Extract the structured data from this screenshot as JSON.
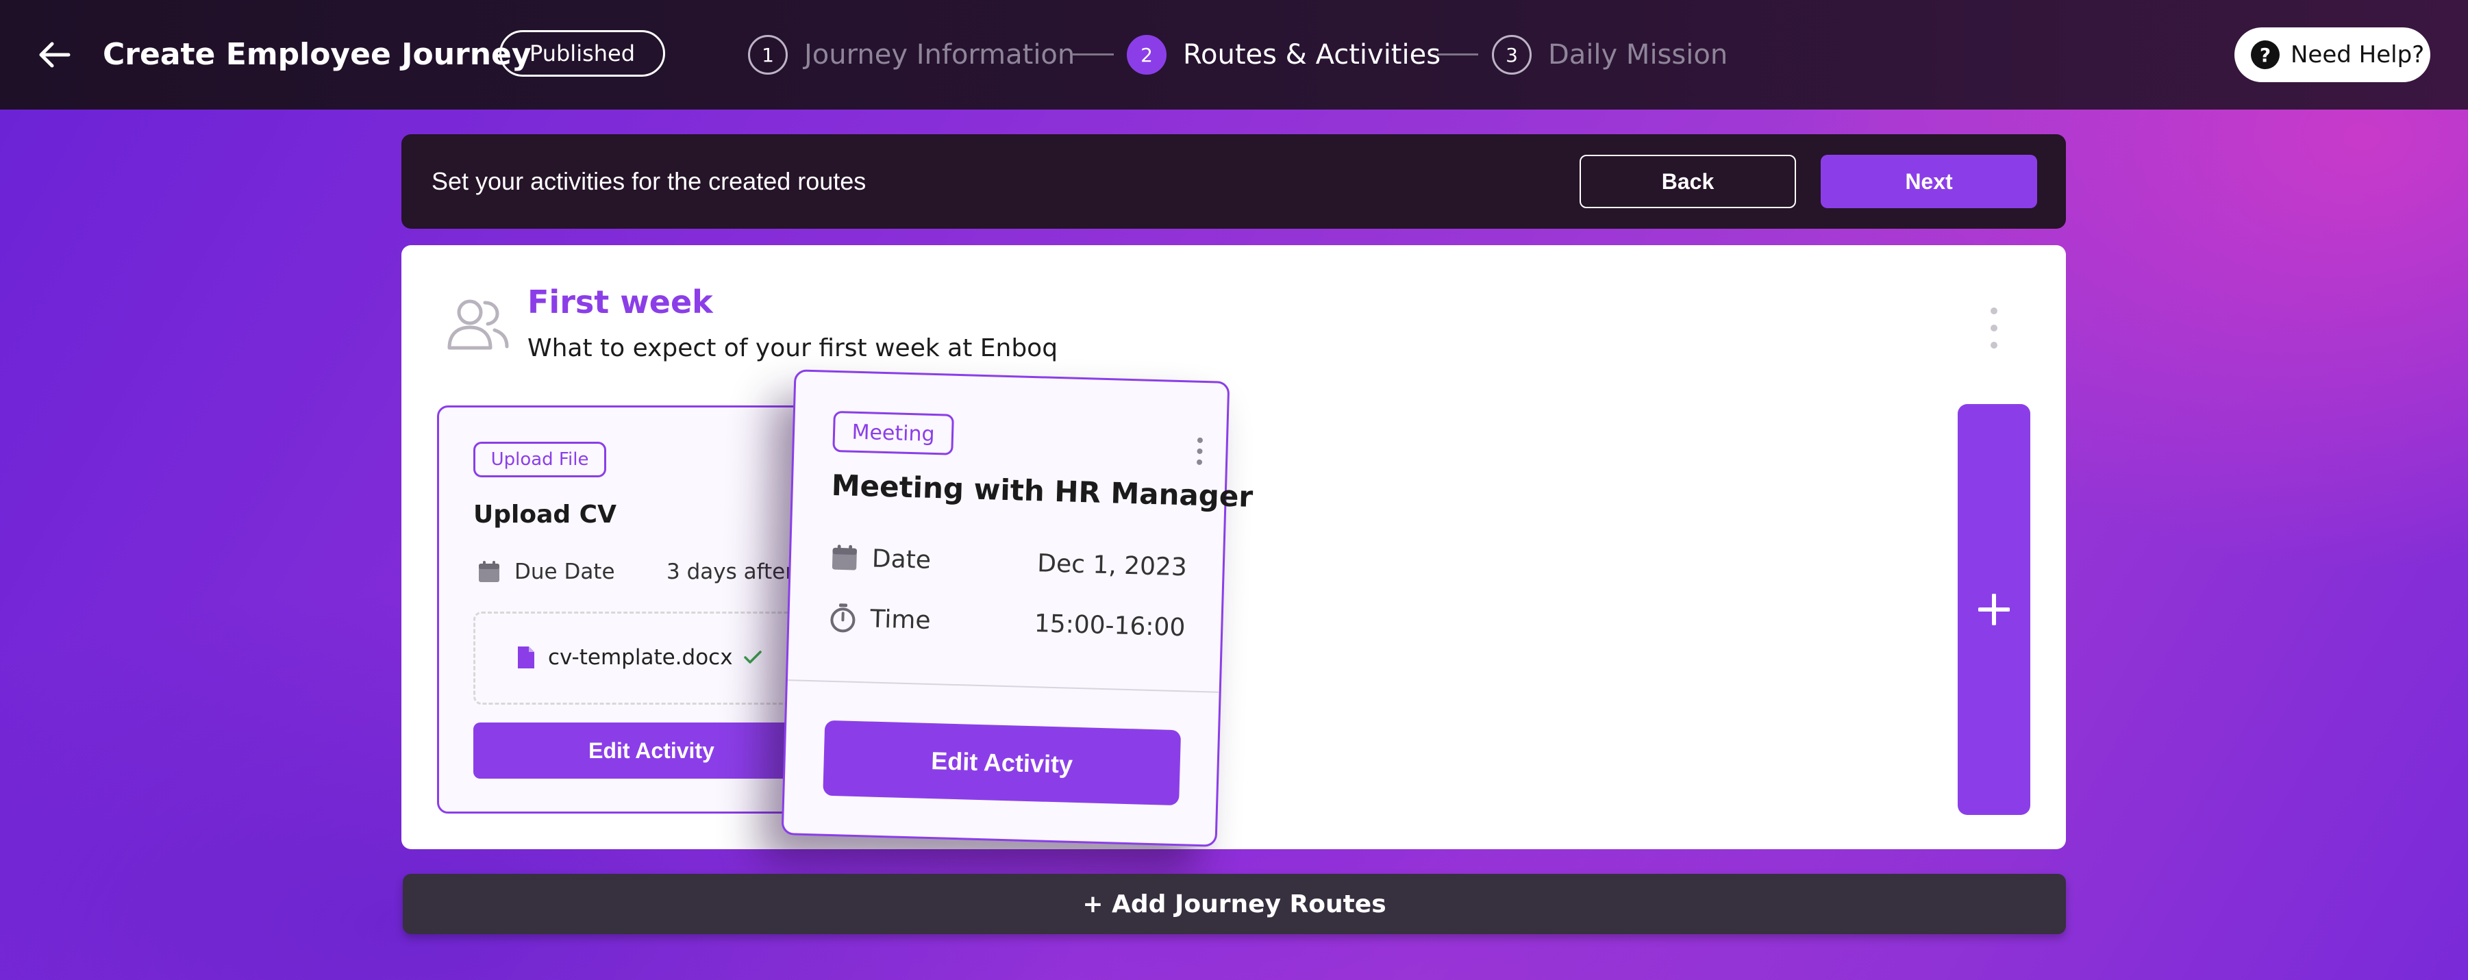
{
  "header": {
    "title": "Create Employee Journey",
    "status_badge": "Published",
    "steps": [
      {
        "number": "1",
        "label": "Journey Information",
        "active": false
      },
      {
        "number": "2",
        "label": "Routes & Activities",
        "active": true
      },
      {
        "number": "3",
        "label": "Daily Mission",
        "active": false
      }
    ],
    "help_label": "Need Help?",
    "help_glyph": "?"
  },
  "action_bar": {
    "instruction": "Set your activities for the created routes",
    "back_label": "Back",
    "next_label": "Next"
  },
  "route": {
    "title": "First week",
    "description": "What to expect of your first week at Enboq",
    "icon": "users-icon"
  },
  "cards": [
    {
      "type_label": "Upload File",
      "title": "Upload CV",
      "due_label": "Due Date",
      "due_value": "3 days after",
      "file_name": "cv-template.docx",
      "edit_label": "Edit Activity"
    },
    {
      "type_label": "Meeting",
      "title": "Meeting with HR Manager",
      "date_label": "Date",
      "date_value": "Dec 1, 2023",
      "time_label": "Time",
      "time_value": "15:00-16:00",
      "edit_label": "Edit Activity"
    }
  ],
  "add_routes_label": "+ Add Journey Routes",
  "colors": {
    "accent": "#8b3ee8",
    "topbar": "#1e1027",
    "action_bar": "#261428",
    "add_routes_bar": "#37303f"
  }
}
